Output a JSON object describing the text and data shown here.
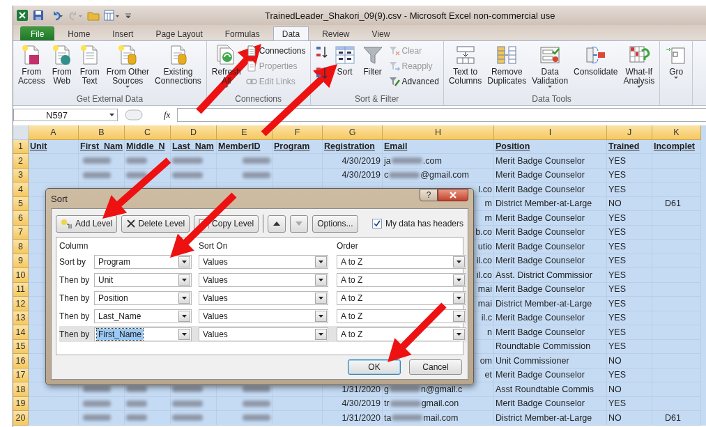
{
  "window": {
    "title": "TrainedLeader_Shakori_09(9).csv  -  Microsoft Excel non-commercial use"
  },
  "tabs": [
    {
      "label": "File",
      "kind": "file",
      "selected": false
    },
    {
      "label": "Home",
      "kind": "plain",
      "selected": false
    },
    {
      "label": "Insert",
      "kind": "plain",
      "selected": false
    },
    {
      "label": "Page Layout",
      "kind": "plain",
      "selected": false
    },
    {
      "label": "Formulas",
      "kind": "plain",
      "selected": false
    },
    {
      "label": "Data",
      "kind": "plain",
      "selected": true
    },
    {
      "label": "Review",
      "kind": "plain",
      "selected": false
    },
    {
      "label": "View",
      "kind": "plain",
      "selected": false
    }
  ],
  "ribbon": {
    "groups": [
      {
        "label": "Get External Data",
        "items": [
          {
            "kind": "large",
            "label": "From\nAccess"
          },
          {
            "kind": "large",
            "label": "From\nWeb"
          },
          {
            "kind": "large",
            "label": "From\nText"
          },
          {
            "kind": "large",
            "label": "From Other\nSources",
            "dropdown": true
          },
          {
            "kind": "large",
            "label": "Existing\nConnections"
          }
        ]
      },
      {
        "label": "Connections",
        "items": [
          {
            "kind": "large",
            "label": "Refresh\nAll",
            "dropdown": true
          },
          {
            "kind": "stack",
            "items": [
              {
                "label": "Connections",
                "disabled": false
              },
              {
                "label": "Properties",
                "disabled": true
              },
              {
                "label": "Edit Links",
                "disabled": true
              }
            ]
          }
        ]
      },
      {
        "label": "Sort & Filter",
        "items": [
          {
            "kind": "sort_pair"
          },
          {
            "kind": "large",
            "label": "Sort"
          },
          {
            "kind": "large",
            "label": "Filter"
          },
          {
            "kind": "stack",
            "items": [
              {
                "label": "Clear",
                "disabled": true
              },
              {
                "label": "Reapply",
                "disabled": true
              },
              {
                "label": "Advanced",
                "disabled": false
              }
            ]
          }
        ]
      },
      {
        "label": "Data Tools",
        "items": [
          {
            "kind": "large",
            "label": "Text to\nColumns"
          },
          {
            "kind": "large",
            "label": "Remove\nDuplicates"
          },
          {
            "kind": "large",
            "label": "Data\nValidation",
            "dropdown": true
          },
          {
            "kind": "large",
            "label": "Consolidate"
          },
          {
            "kind": "large",
            "label": "What-If\nAnalysis",
            "dropdown": true
          }
        ]
      },
      {
        "items": [
          {
            "kind": "large",
            "label": "Gro",
            "dropdown": true
          }
        ]
      }
    ]
  },
  "formula_bar": {
    "name_box": "N597",
    "function_label": "fx"
  },
  "sheet": {
    "all_selected": true,
    "columns": [
      "A",
      "B",
      "C",
      "D",
      "E",
      "F",
      "G",
      "H",
      "I",
      "J",
      "K"
    ],
    "rows": [
      {
        "number": "1",
        "kind": "header",
        "cells": [
          "Unit",
          "First_Nam",
          "Middle_N",
          "Last_Nam",
          "MemberID",
          "Program",
          "Registration",
          "Email",
          "Position",
          "Trained",
          "Incomplet"
        ]
      },
      {
        "number": "2",
        "kind": "data",
        "names_blurred": true,
        "registration": "4/30/2019",
        "email": [
          "ja",
          ".com"
        ],
        "position": "Merit Badge Counselor",
        "trained": "YES"
      },
      {
        "number": "3",
        "kind": "data",
        "names_blurred": true,
        "registration": "4/30/2019",
        "email": [
          "c",
          "@gmail.com"
        ],
        "position": "Merit Badge Counselor",
        "trained": "YES"
      },
      {
        "number": "4",
        "kind": "covered",
        "email": "l.co",
        "position": "Merit Badge Counselor",
        "trained": "YES"
      },
      {
        "number": "5",
        "kind": "covered",
        "email": "m",
        "position": "District Member-at-Large",
        "trained": "NO",
        "incomplete": "D61"
      },
      {
        "number": "6",
        "kind": "covered",
        "email": "m",
        "position": "Merit Badge Counselor",
        "trained": "YES"
      },
      {
        "number": "7",
        "kind": "covered",
        "email": "b.co",
        "position": "Merit Badge Counselor",
        "trained": "YES"
      },
      {
        "number": "8",
        "kind": "covered",
        "email": "utio",
        "position": "Merit Badge Counselor",
        "trained": "YES"
      },
      {
        "number": "9",
        "kind": "covered",
        "email": "il.co",
        "position": "Merit Badge Counselor",
        "trained": "YES"
      },
      {
        "number": "10",
        "kind": "covered",
        "email": "il.co",
        "position": "Asst. District Commissior",
        "trained": "YES"
      },
      {
        "number": "11",
        "kind": "covered",
        "email": "mai",
        "position": "Merit Badge Counselor",
        "trained": "YES"
      },
      {
        "number": "12",
        "kind": "covered",
        "email": "mai",
        "position": "District Member-at-Large",
        "trained": "YES"
      },
      {
        "number": "13",
        "kind": "covered",
        "email": "il.c",
        "position": "Merit Badge Counselor",
        "trained": "YES"
      },
      {
        "number": "14",
        "kind": "covered",
        "email": "n",
        "position": "Merit Badge Counselor",
        "trained": "YES"
      },
      {
        "number": "15",
        "kind": "covered",
        "position": "Roundtable Commission",
        "trained": "YES"
      },
      {
        "number": "16",
        "kind": "covered",
        "email": "om",
        "position": "Unit Commissioner",
        "trained": "NO"
      },
      {
        "number": "17",
        "kind": "covered",
        "email": "et",
        "position": "Merit Badge Counselor",
        "trained": "YES"
      },
      {
        "number": "18",
        "kind": "data",
        "names_blurred": true,
        "registration": "1/31/2020",
        "email": [
          "g",
          "n@gmail.c"
        ],
        "position": "Asst Roundtable Commis",
        "trained": "NO"
      },
      {
        "number": "19",
        "kind": "data",
        "names_blurred": true,
        "registration": "4/30/2019",
        "email": [
          "tr",
          "gmail.con"
        ],
        "position": "Merit Badge Counselor",
        "trained": "YES"
      },
      {
        "number": "20",
        "kind": "data",
        "names_blurred": true,
        "registration": "1/31/2020",
        "email": [
          "ta",
          "mail.com"
        ],
        "position": "District Member-at-Large",
        "trained": "NO",
        "incomplete": "D61"
      }
    ]
  },
  "sort_dialog": {
    "title": "Sort",
    "help_label": "?",
    "toolbar": [
      {
        "kind": "add",
        "label": "Add Level",
        "disabled": false
      },
      {
        "kind": "delete",
        "label": "Delete Level",
        "disabled": false
      },
      {
        "kind": "copy",
        "label": "Copy Level",
        "disabled": false
      },
      {
        "kind": "up",
        "disabled": false
      },
      {
        "kind": "down",
        "disabled": true
      },
      {
        "kind": "plain",
        "label": "Options...",
        "disabled": false
      }
    ],
    "headers_checkbox": {
      "label": "My data has headers",
      "checked": true
    },
    "column_headings": [
      "Column",
      "Sort On",
      "Order"
    ],
    "levels": [
      {
        "label": "Sort by",
        "column": "Program",
        "sort_on": "Values",
        "order": "A to Z",
        "selected": false
      },
      {
        "label": "Then by",
        "column": "Unit",
        "sort_on": "Values",
        "order": "A to Z",
        "selected": false
      },
      {
        "label": "Then by",
        "column": "Position",
        "sort_on": "Values",
        "order": "A to Z",
        "selected": false
      },
      {
        "label": "Then by",
        "column": "Last_Name",
        "sort_on": "Values",
        "order": "A to Z",
        "selected": false
      },
      {
        "label": "Then by",
        "column": "First_Name",
        "sort_on": "Values",
        "order": "A to Z",
        "selected": true
      }
    ],
    "buttons": [
      {
        "label": "OK",
        "default": true
      },
      {
        "label": "Cancel",
        "default": false
      }
    ]
  }
}
